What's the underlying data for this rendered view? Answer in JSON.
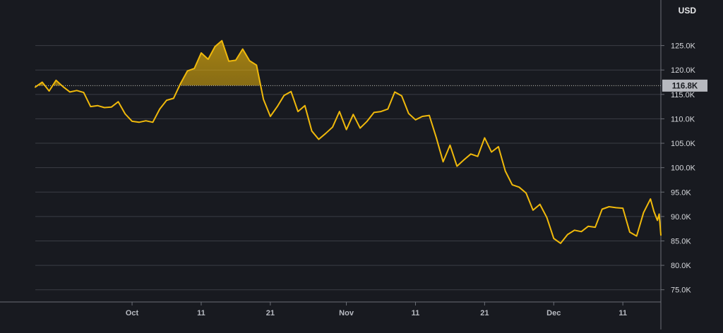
{
  "chart_data": {
    "type": "line",
    "currency": "USD",
    "y_ticks": [
      {
        "value": 75000,
        "label": "75.0K"
      },
      {
        "value": 80000,
        "label": "80.0K"
      },
      {
        "value": 85000,
        "label": "85.0K"
      },
      {
        "value": 90000,
        "label": "90.0K"
      },
      {
        "value": 95000,
        "label": "95.0K"
      },
      {
        "value": 100000,
        "label": "100.0K"
      },
      {
        "value": 105000,
        "label": "105.0K"
      },
      {
        "value": 110000,
        "label": "110.0K"
      },
      {
        "value": 115000,
        "label": "115.0K"
      },
      {
        "value": 120000,
        "label": "120.0K"
      },
      {
        "value": 125000,
        "label": "125.0K"
      }
    ],
    "x_ticks": [
      {
        "date": "2025-10-01",
        "label": "Oct"
      },
      {
        "date": "2025-10-11",
        "label": "11"
      },
      {
        "date": "2025-10-21",
        "label": "21"
      },
      {
        "date": "2025-11-01",
        "label": "Nov"
      },
      {
        "date": "2025-11-11",
        "label": "11"
      },
      {
        "date": "2025-11-21",
        "label": "21"
      },
      {
        "date": "2025-12-01",
        "label": "Dec"
      },
      {
        "date": "2025-12-11",
        "label": "11"
      }
    ],
    "reference_value": 116800,
    "reference_label": "116.8K",
    "ylim": [
      72500,
      130000
    ],
    "xlim": [
      "2025-09-17",
      "2025-12-16T12:00"
    ],
    "grid": "horizontal",
    "line_color": "#f0b90b",
    "fill_color": "#f0b90b",
    "background_color": "#181a20",
    "grid_color": "#3a3d45",
    "reference_line_color": "#b7b9bf",
    "label_bg_color": "#b7b9bf",
    "series": [
      {
        "points": [
          [
            "2025-09-17",
            116500
          ],
          [
            "2025-09-18",
            117500
          ],
          [
            "2025-09-19",
            115700
          ],
          [
            "2025-09-20",
            117900
          ],
          [
            "2025-09-21",
            116600
          ],
          [
            "2025-09-22",
            115500
          ],
          [
            "2025-09-23",
            115800
          ],
          [
            "2025-09-24",
            115400
          ],
          [
            "2025-09-25",
            112500
          ],
          [
            "2025-09-26",
            112700
          ],
          [
            "2025-09-27",
            112300
          ],
          [
            "2025-09-28",
            112400
          ],
          [
            "2025-09-29",
            113500
          ],
          [
            "2025-09-30",
            111000
          ],
          [
            "2025-10-01",
            109500
          ],
          [
            "2025-10-02",
            109300
          ],
          [
            "2025-10-03",
            109600
          ],
          [
            "2025-10-04",
            109300
          ],
          [
            "2025-10-05",
            112000
          ],
          [
            "2025-10-06",
            113800
          ],
          [
            "2025-10-07",
            114200
          ],
          [
            "2025-10-08",
            117200
          ],
          [
            "2025-10-09",
            119800
          ],
          [
            "2025-10-10",
            120300
          ],
          [
            "2025-10-11",
            123500
          ],
          [
            "2025-10-12",
            122200
          ],
          [
            "2025-10-13",
            124800
          ],
          [
            "2025-10-14",
            126000
          ],
          [
            "2025-10-15",
            121800
          ],
          [
            "2025-10-16",
            122000
          ],
          [
            "2025-10-17",
            124300
          ],
          [
            "2025-10-18",
            121900
          ],
          [
            "2025-10-19",
            121000
          ],
          [
            "2025-10-20",
            114000
          ],
          [
            "2025-10-21",
            110500
          ],
          [
            "2025-10-22",
            112500
          ],
          [
            "2025-10-23",
            114800
          ],
          [
            "2025-10-24",
            115600
          ],
          [
            "2025-10-25",
            111500
          ],
          [
            "2025-10-26",
            112700
          ],
          [
            "2025-10-27",
            107500
          ],
          [
            "2025-10-28",
            105800
          ],
          [
            "2025-10-29",
            107000
          ],
          [
            "2025-10-30",
            108300
          ],
          [
            "2025-10-31",
            111500
          ],
          [
            "2025-11-01",
            107800
          ],
          [
            "2025-11-02",
            110900
          ],
          [
            "2025-11-03",
            108100
          ],
          [
            "2025-11-04",
            109500
          ],
          [
            "2025-11-05",
            111300
          ],
          [
            "2025-11-06",
            111500
          ],
          [
            "2025-11-07",
            112000
          ],
          [
            "2025-11-08",
            115500
          ],
          [
            "2025-11-09",
            114700
          ],
          [
            "2025-11-10",
            111100
          ],
          [
            "2025-11-11",
            109800
          ],
          [
            "2025-11-12",
            110500
          ],
          [
            "2025-11-13",
            110700
          ],
          [
            "2025-11-14",
            106200
          ],
          [
            "2025-11-15",
            101200
          ],
          [
            "2025-11-16",
            104600
          ],
          [
            "2025-11-17",
            100300
          ],
          [
            "2025-11-18",
            101600
          ],
          [
            "2025-11-19",
            102800
          ],
          [
            "2025-11-20",
            102300
          ],
          [
            "2025-11-21",
            106100
          ],
          [
            "2025-11-22",
            103200
          ],
          [
            "2025-11-23",
            104300
          ],
          [
            "2025-11-24",
            99300
          ],
          [
            "2025-11-25",
            96500
          ],
          [
            "2025-11-26",
            96000
          ],
          [
            "2025-11-27",
            94800
          ],
          [
            "2025-11-28",
            91300
          ],
          [
            "2025-11-29",
            92500
          ],
          [
            "2025-11-30",
            89800
          ],
          [
            "2025-12-01",
            85500
          ],
          [
            "2025-12-02",
            84500
          ],
          [
            "2025-12-03",
            86300
          ],
          [
            "2025-12-04",
            87200
          ],
          [
            "2025-12-05",
            86900
          ],
          [
            "2025-12-06",
            88000
          ],
          [
            "2025-12-07",
            87800
          ],
          [
            "2025-12-08",
            91500
          ],
          [
            "2025-12-09",
            92000
          ],
          [
            "2025-12-10",
            91800
          ],
          [
            "2025-12-11",
            91700
          ],
          [
            "2025-12-12",
            86800
          ],
          [
            "2025-12-13",
            86000
          ],
          [
            "2025-12-14",
            90800
          ],
          [
            "2025-12-15",
            93600
          ],
          [
            "2025-12-15T12:00",
            91000
          ],
          [
            "2025-12-16",
            89200
          ],
          [
            "2025-12-16T06:00",
            90500
          ],
          [
            "2025-12-16T12:00",
            86200
          ]
        ]
      }
    ]
  }
}
